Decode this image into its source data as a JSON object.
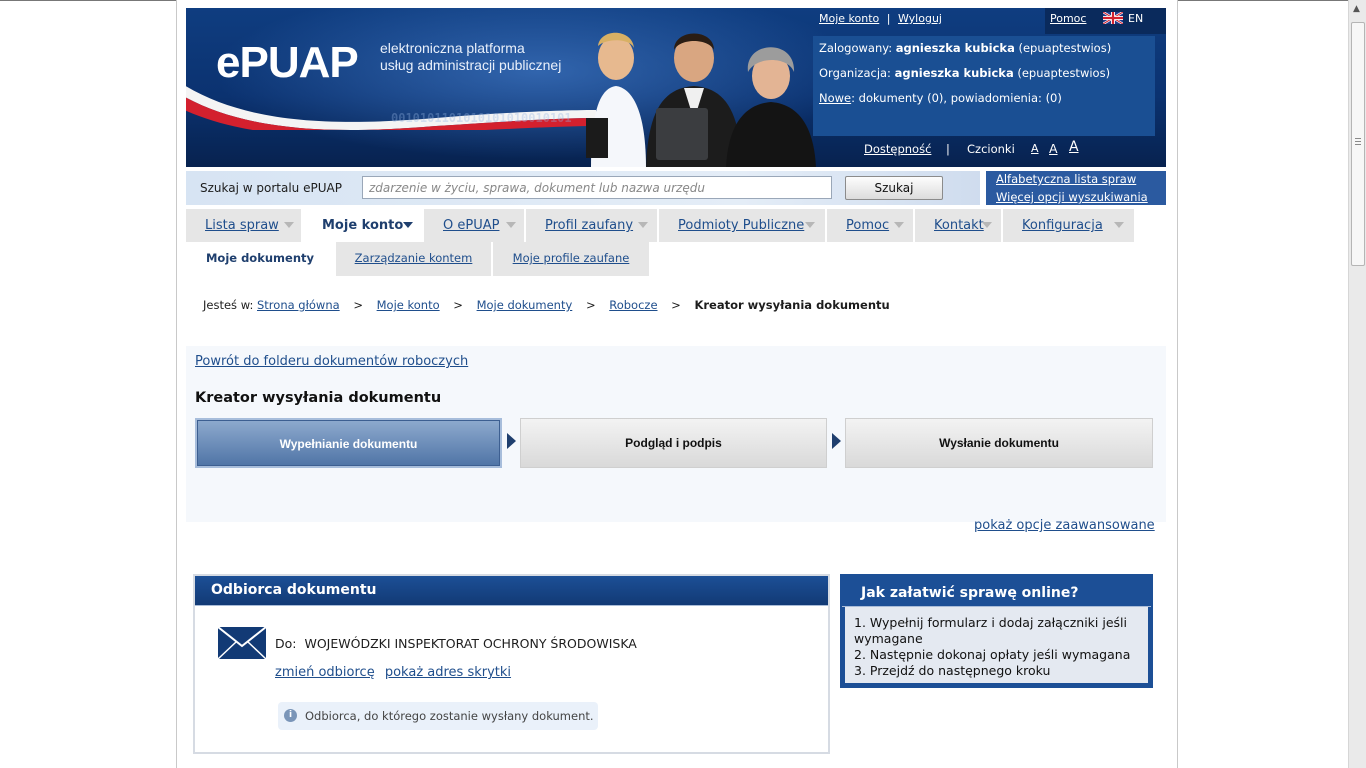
{
  "header": {
    "logo_text": "ePUAP",
    "tagline_line1": "elektroniczna platforma",
    "tagline_line2": "usług administracji publicznej",
    "binary_text": "0010101101010101010010101",
    "links": {
      "my_account": "Moje konto",
      "separator": "|",
      "logout": "Wyloguj",
      "help": "Pomoc",
      "language": "EN"
    },
    "user": {
      "logged_label": "Zalogowany:",
      "logged_name": "agnieszka kubicka",
      "logged_id": "(epuaptestwios)",
      "org_label": "Organizacja:",
      "org_name": "agnieszka kubicka",
      "org_id": "(epuaptestwios)",
      "new_link": "Nowe",
      "new_text": ": dokumenty (0), powiadomienia: (0)"
    },
    "accessibility": {
      "label": "Dostępność",
      "separator": "|",
      "fonts_label": "Czcionki",
      "font_small": "A",
      "font_medium": "A",
      "font_large": "A"
    }
  },
  "search": {
    "label": "Szukaj w portalu ePUAP",
    "placeholder": "zdarzenie w życiu, sprawa, dokument lub nazwa urzędu",
    "button": "Szukaj",
    "link_alphabetical": "Alfabetyczna lista spraw",
    "link_more": "Więcej opcji wyszukiwania"
  },
  "nav": {
    "tabs": [
      {
        "label": "Lista spraw"
      },
      {
        "label": "Moje konto"
      },
      {
        "label": "O ePUAP"
      },
      {
        "label": "Profil zaufany"
      },
      {
        "label": "Podmioty Publiczne"
      },
      {
        "label": "Pomoc"
      },
      {
        "label": "Kontakt"
      },
      {
        "label": "Konfiguracja"
      }
    ],
    "subtabs": [
      {
        "label": "Moje dokumenty"
      },
      {
        "label": "Zarządzanie kontem"
      },
      {
        "label": "Moje profile zaufane"
      }
    ]
  },
  "breadcrumb": {
    "prefix": "Jesteś w:",
    "items": [
      "Strona główna",
      "Moje konto",
      "Moje dokumenty",
      "Robocze"
    ],
    "separator": ">",
    "current": "Kreator wysyłania dokumentu"
  },
  "page": {
    "back_link": "Powrót do folderu dokumentów roboczych",
    "title": "Kreator wysyłania dokumentu",
    "steps": [
      "Wypełnianie dokumentu",
      "Podgląd i podpis",
      "Wysłanie dokumentu"
    ],
    "advanced_link": "pokaż opcje zaawansowane"
  },
  "recipient_panel": {
    "title": "Odbiorca dokumentu",
    "to_label": "Do:",
    "to_value": "WOJEWÓDZKI INSPEKTORAT OCHRONY ŚRODOWISKA",
    "change_link": "zmień odbiorcę",
    "address_link": "pokaż adres skrytki",
    "hint": "Odbiorca, do którego zostanie wysłany dokument."
  },
  "howto_panel": {
    "title": "Jak załatwić sprawę online?",
    "items": [
      "1. Wypełnij formularz i dodaj załączniki jeśli wymagane",
      "2. Następnie dokonaj opłaty jeśli wymagana",
      "3. Przejdź do następnego kroku"
    ]
  },
  "icons": [
    "flag-pl-ribbon-icon",
    "flag-uk-icon",
    "envelope-icon",
    "info-icon",
    "dropdown-arrow-icon",
    "step-arrow-icon"
  ],
  "colors": {
    "primary": "#1c4f96",
    "link": "#1f4e8c",
    "header_dark": "#0b3270"
  }
}
